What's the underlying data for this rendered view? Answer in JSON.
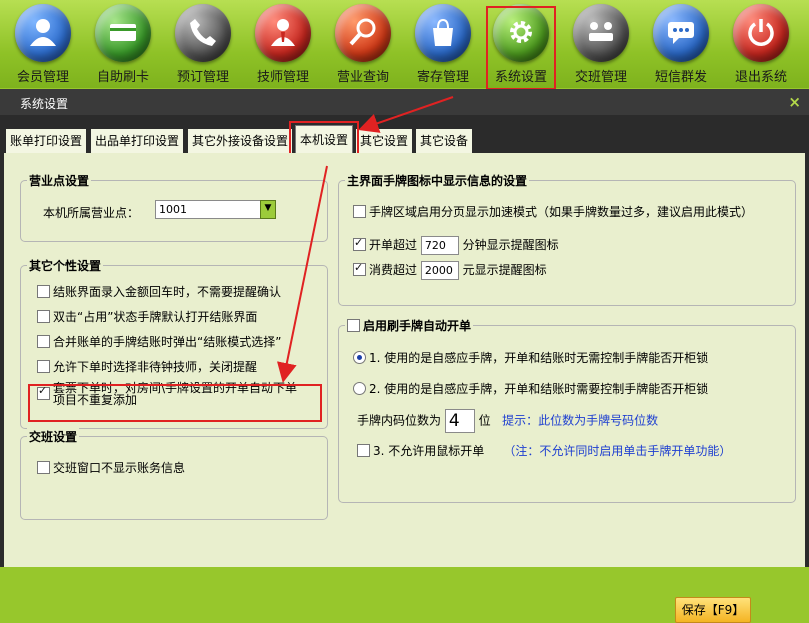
{
  "toolbar": {
    "items": [
      {
        "label": "会员管理",
        "icon": "member-icon",
        "color": "#2f6fd0"
      },
      {
        "label": "自助刷卡",
        "icon": "card-icon",
        "color": "#3a9a2a"
      },
      {
        "label": "预订管理",
        "icon": "phone-icon",
        "color": "#555555"
      },
      {
        "label": "技师管理",
        "icon": "technician-icon",
        "color": "#c82820"
      },
      {
        "label": "营业查询",
        "icon": "magnifier-icon",
        "color": "#d13a18"
      },
      {
        "label": "寄存管理",
        "icon": "bag-icon",
        "color": "#2c6ac8"
      },
      {
        "label": "系统设置",
        "icon": "gear-icon",
        "color": "#4f9d20"
      },
      {
        "label": "交班管理",
        "icon": "handover-icon",
        "color": "#555555"
      },
      {
        "label": "短信群发",
        "icon": "sms-icon",
        "color": "#2c6ac8"
      },
      {
        "label": "退出系统",
        "icon": "power-icon",
        "color": "#c82820"
      }
    ]
  },
  "window": {
    "title": "系统设置",
    "close_label": "×"
  },
  "tabs": [
    "账单打印设置",
    "出品单打印设置",
    "其它外接设备设置",
    "本机设置",
    "其它设置",
    "其它设备"
  ],
  "active_tab": "本机设置",
  "business_point": {
    "title": "营业点设置",
    "label": "本机所属营业点：",
    "value": "1001"
  },
  "personal": {
    "title": "其它个性设置",
    "items": [
      {
        "label": "结账界面录入金额回车时，不需要提醒确认",
        "checked": false
      },
      {
        "label": "双击“占用”状态手牌默认打开结账界面",
        "checked": false
      },
      {
        "label": "合并账单的手牌结账时弹出“结账模式选择”",
        "checked": false
      },
      {
        "label": "允许下单时选择非待钟技师，关闭提醒",
        "checked": false
      },
      {
        "label": "套票下单时，对房间\\手牌设置的开单自动下单",
        "label2": "项目不重复添加",
        "checked": true
      }
    ]
  },
  "shift": {
    "title": "交班设置",
    "item": "交班窗口不显示账务信息"
  },
  "main_icons": {
    "title": "主界面手牌图标中显示信息的设置",
    "paging": "手牌区域启用分页显示加速模式（如果手牌数量过多，建议启用此模式）",
    "open_prefix": "开单超过",
    "open_value": "720",
    "open_suffix": "分钟显示提醒图标",
    "spend_prefix": "消费超过",
    "spend_value": "2000",
    "spend_suffix": "元显示提醒图标"
  },
  "auto_open": {
    "title": "启用刷手牌自动开单",
    "opt1": "1. 使用的是自感应手牌，开单和结账时无需控制手牌能否开柜锁",
    "opt2": "2. 使用的是自感应手牌，开单和结账时需要控制手牌能否开柜锁",
    "code_label": "手牌内码位数为",
    "code_value": "4",
    "code_unit": "位",
    "code_hint": "提示：此位数为手牌号码位数",
    "mouse": "3. 不允许用鼠标开单",
    "mouse_note": "（注：不允许同时启用单击手牌开单功能）"
  },
  "save_label": "保存【F9】"
}
